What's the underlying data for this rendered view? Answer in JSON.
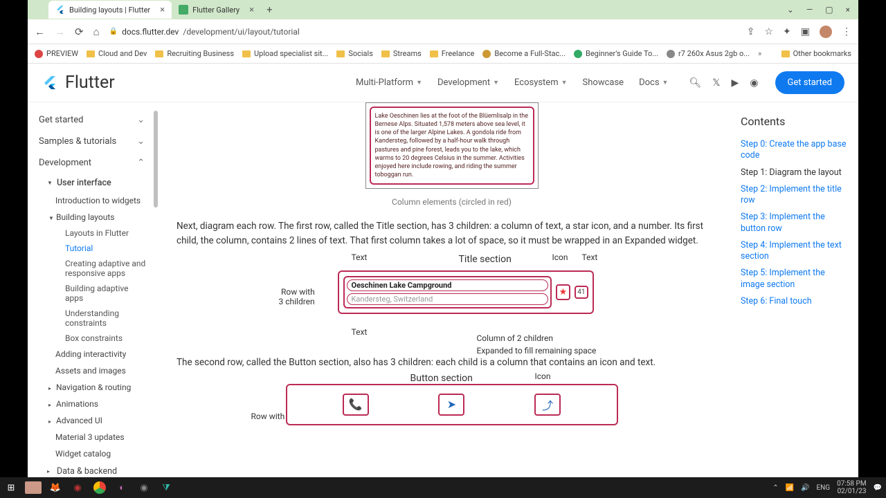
{
  "tabs": [
    {
      "title": "Building layouts | Flutter",
      "active": true
    },
    {
      "title": "Flutter Gallery",
      "active": false
    }
  ],
  "url": {
    "host": "docs.flutter.dev",
    "path": "/development/ui/layout/tutorial"
  },
  "bookmarks": [
    "PREVIEW",
    "Cloud and Dev",
    "Recruiting Business",
    "Upload specialist sit...",
    "Socials",
    "Streams",
    "Freelance",
    "Become a Full-Stac...",
    "Beginner's Guide To...",
    "r7 260x Asus 2gb o..."
  ],
  "other_bookmarks": "Other bookmarks",
  "brand": "Flutter",
  "nav": [
    "Multi-Platform",
    "Development",
    "Ecosystem",
    "Showcase",
    "Docs"
  ],
  "get_started": "Get started",
  "sidebar": {
    "top": [
      "Get started",
      "Samples & tutorials",
      "Development"
    ],
    "user_interface": "User interface",
    "items": [
      "Introduction to widgets"
    ],
    "building_layouts": "Building layouts",
    "layouts_children": [
      "Layouts in Flutter",
      "Tutorial",
      "Creating adaptive and responsive apps",
      "Building adaptive apps",
      "Understanding constraints",
      "Box constraints"
    ],
    "after": [
      "Adding interactivity",
      "Assets and images",
      "Navigation & routing",
      "Animations",
      "Advanced UI",
      "Material 3 updates",
      "Widget catalog"
    ],
    "data_backend": "Data & backend"
  },
  "content": {
    "column_text": "Lake Oeschinen lies at the foot of the Blüemlisalp in the Bernese Alps. Situated 1,578 meters above sea level, it is one of the larger Alpine Lakes. A gondola ride from Kandersteg, followed by a half-hour walk through pastures and pine forest, leads you to the lake, which warms to 20 degrees Celsius in the summer. Activities enjoyed here include rowing, and riding the summer toboggan run.",
    "caption": "Column elements (circled in red)",
    "para1": "Next, diagram each row. The first row, called the Title section, has 3 children: a column of text, a star icon, and a number. Its first child, the column, contains 2 lines of text. That first column takes a lot of space, so it must be wrapped in an Expanded widget.",
    "title_section": {
      "heading": "Title section",
      "text_label": "Text",
      "icon_label": "Icon",
      "row_label": "Row with\n3 children",
      "line1": "Oeschinen Lake Campground",
      "line2": "Kandersteg, Switzerland",
      "number": "41",
      "col_label": "Column of 2 children",
      "exp_label": "Expanded to fill remaining space"
    },
    "para2": "The second row, called the Button section, also has 3 children: each child is a column that contains an icon and text.",
    "button_section": {
      "heading": "Button section",
      "icon_label": "Icon",
      "row_label": "Row with"
    }
  },
  "toc": {
    "title": "Contents",
    "items": [
      {
        "label": "Step 0: Create the app base code",
        "current": false
      },
      {
        "label": "Step 1: Diagram the layout",
        "current": true
      },
      {
        "label": "Step 2: Implement the title row",
        "current": false
      },
      {
        "label": "Step 3: Implement the button row",
        "current": false
      },
      {
        "label": "Step 4: Implement the text section",
        "current": false
      },
      {
        "label": "Step 5: Implement the image section",
        "current": false
      },
      {
        "label": "Step 6: Final touch",
        "current": false
      }
    ]
  },
  "taskbar": {
    "lang": "ENG",
    "time": "07:58 PM",
    "date": "02/01/23"
  }
}
